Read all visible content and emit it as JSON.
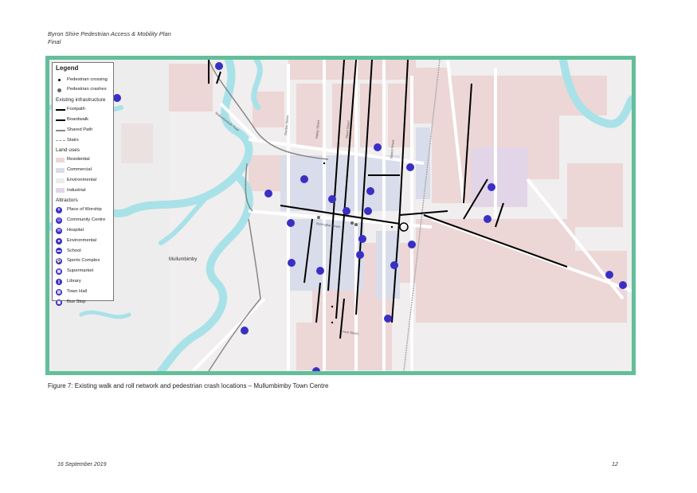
{
  "header": {
    "line1": "Byron Shire Pedestrian Access & Mobility Plan",
    "line2": "Final"
  },
  "map": {
    "town_label": "Mullumbimby",
    "road_labels": {
      "burringbar_street": "Burringbar Street",
      "dalley_street": "Dalley Street",
      "stuart_street": "Stuart Street",
      "gordon_street": "Gordon Street",
      "station_street": "Station Street",
      "fern_street": "Fern Street",
      "mullumbimbah_road": "Mullumbimbah Road"
    },
    "colors": {
      "frame": "#62bf9a",
      "background": "#f0eeee",
      "residential": "#ecd6d6",
      "commercial": "#d9dcea",
      "environmental": "#ebebeb",
      "industrial": "#e3d5e8",
      "river": "#a8e2e8",
      "road": "#ffffff",
      "icon": "#3a2fc4"
    }
  },
  "legend": {
    "title": "Legend",
    "point_items": [
      {
        "label": "Pedestrian crossing",
        "symbol": "small-dot"
      },
      {
        "label": "Pedestrian crashes",
        "symbol": "grey-dot"
      }
    ],
    "infrastructure_title": "Existing infrastructure",
    "infrastructure_items": [
      {
        "label": "Footpath",
        "symbol": "solid"
      },
      {
        "label": "Boardwalk",
        "symbol": "dashed"
      },
      {
        "label": "Shared Path",
        "symbol": "grey"
      },
      {
        "label": "Stairs",
        "symbol": "stairs"
      }
    ],
    "land_uses_title": "Land uses",
    "land_use_items": [
      {
        "label": "Residential",
        "color": "#ecd6d6"
      },
      {
        "label": "Commercial",
        "color": "#d9dcea"
      },
      {
        "label": "Environmental",
        "color": "#ebebeb"
      },
      {
        "label": "Industrial",
        "color": "#e3d5e8"
      }
    ],
    "attractors_title": "Attractors",
    "attractor_items": [
      {
        "label": "Place of Worship",
        "icon": "place-of-worship-icon",
        "glyph": "✝"
      },
      {
        "label": "Community Centre",
        "icon": "community-centre-icon",
        "glyph": "⚇"
      },
      {
        "label": "Hospital",
        "icon": "hospital-icon",
        "glyph": "H"
      },
      {
        "label": "Environmental",
        "icon": "environmental-icon",
        "glyph": "♣"
      },
      {
        "label": "School",
        "icon": "school-icon",
        "glyph": "▬"
      },
      {
        "label": "Sports Complex",
        "icon": "sports-complex-icon",
        "glyph": "⚽"
      },
      {
        "label": "Supermarket",
        "icon": "supermarket-icon",
        "glyph": "▤"
      },
      {
        "label": "Library",
        "icon": "library-icon",
        "glyph": "▯"
      },
      {
        "label": "Town Hall",
        "icon": "town-hall-icon",
        "glyph": "▥"
      },
      {
        "label": "Bus Stop",
        "icon": "bus-stop-icon",
        "glyph": "▣"
      }
    ]
  },
  "caption": "Figure 7: Existing walk and roll network and pedestrian crash locations – Mullumbimby Town Centre",
  "footer": {
    "date": "16 September 2019",
    "page": "12"
  }
}
